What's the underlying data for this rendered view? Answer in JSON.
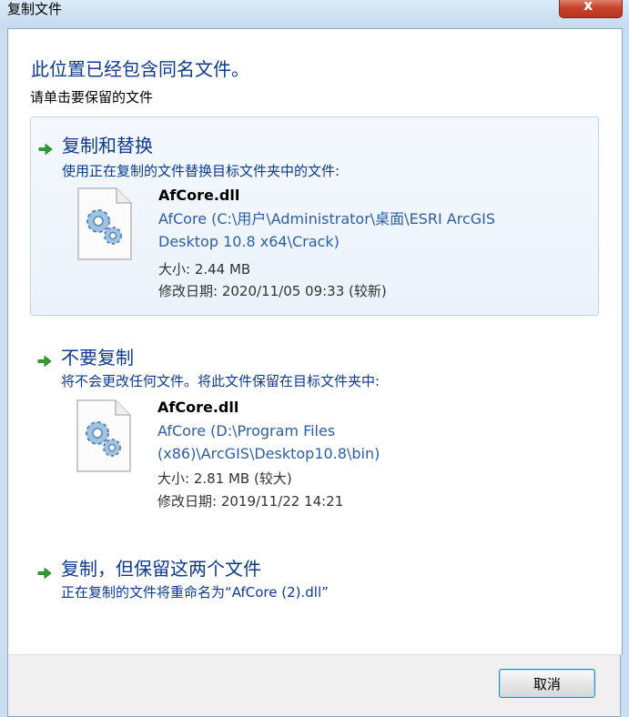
{
  "window": {
    "title": "复制文件",
    "close_glyph": "x"
  },
  "dialog": {
    "heading": "此位置已经包含同名文件。",
    "subheading": "请单击要保留的文件"
  },
  "options": [
    {
      "title": "复制和替换",
      "description": "使用正在复制的文件替换目标文件夹中的文件:",
      "file": {
        "name": "AfCore.dll",
        "path": "AfCore (C:\\用户\\Administrator\\桌面\\ESRI ArcGIS Desktop 10.8 x64\\Crack)",
        "size": "大小: 2.44 MB",
        "modified": "修改日期: 2020/11/05 09:33 (较新)"
      },
      "selected": true
    },
    {
      "title": "不要复制",
      "description": "将不会更改任何文件。将此文件保留在目标文件夹中:",
      "file": {
        "name": "AfCore.dll",
        "path": "AfCore (D:\\Program Files (x86)\\ArcGIS\\Desktop10.8\\bin)",
        "size": "大小: 2.81 MB (较大)",
        "modified": "修改日期: 2019/11/22 14:21"
      },
      "selected": false
    },
    {
      "title": "复制，但保留这两个文件",
      "description": "正在复制的文件将重命名为“AfCore (2).dll”",
      "selected": false
    }
  ],
  "footer": {
    "cancel_label": "取消"
  },
  "icons": {
    "option_arrow": "green-arrow-icon",
    "file": "dll-file-gear-icon"
  },
  "colors": {
    "link_blue": "#0b3a95",
    "path_blue": "#2b5ea8",
    "arrow_green": "#2ca02c",
    "close_red": "#c9442c"
  }
}
